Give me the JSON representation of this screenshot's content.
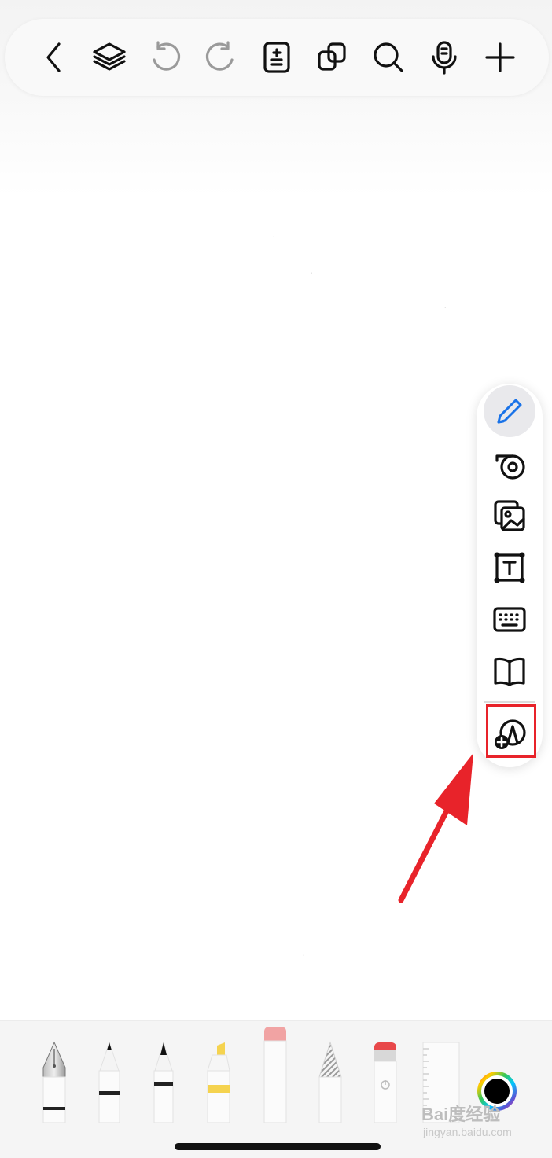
{
  "toolbar": {
    "buttons": [
      {
        "icon": "back-icon"
      },
      {
        "icon": "layers-icon"
      },
      {
        "icon": "undo-icon",
        "enabled": false
      },
      {
        "icon": "redo-icon",
        "enabled": false
      },
      {
        "icon": "page-add-icon"
      },
      {
        "icon": "copy-icon"
      },
      {
        "icon": "search-icon"
      },
      {
        "icon": "microphone-icon"
      },
      {
        "icon": "plus-icon"
      }
    ]
  },
  "side_panel": {
    "items": [
      {
        "icon": "pen-icon",
        "active": true,
        "color": "#1a73e8"
      },
      {
        "icon": "tape-icon"
      },
      {
        "icon": "image-icon"
      },
      {
        "icon": "textbox-icon",
        "label": "T"
      },
      {
        "icon": "keyboard-icon"
      },
      {
        "icon": "book-icon"
      },
      {
        "icon": "add-shape-icon",
        "highlighted": true
      }
    ],
    "highlight_color": "#e8232a"
  },
  "bottom_tools": [
    {
      "icon": "fountain-pen-icon"
    },
    {
      "icon": "ballpoint-pen-icon"
    },
    {
      "icon": "fine-pen-icon"
    },
    {
      "icon": "highlighter-icon",
      "color": "#f5d34f"
    },
    {
      "icon": "eraser-icon",
      "color": "#f1a3a3"
    },
    {
      "icon": "pencil-icon"
    },
    {
      "icon": "lasso-icon",
      "color": "#e8484a"
    },
    {
      "icon": "ruler-icon"
    },
    {
      "icon": "color-picker-icon",
      "selected_color": "#000000"
    }
  ],
  "watermark": {
    "brand": "Bai度经验",
    "url": "jingyan.baidu.com"
  }
}
